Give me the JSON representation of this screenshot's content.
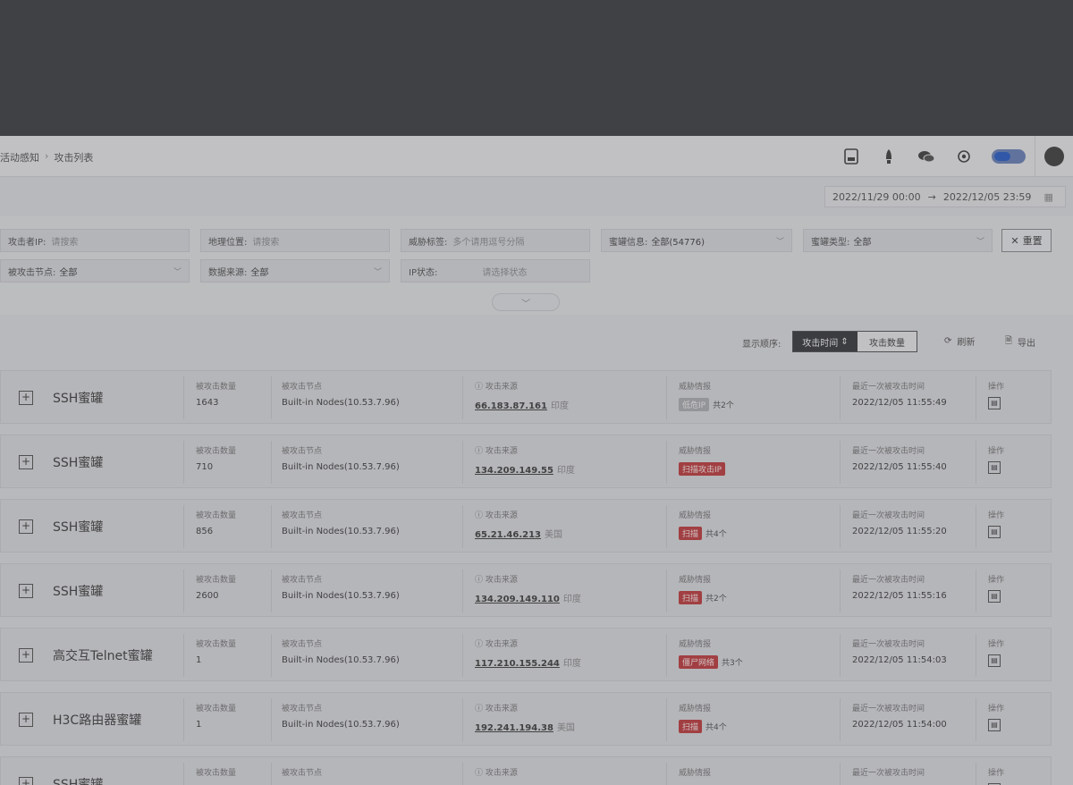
{
  "breadcrumb": [
    "活动感知",
    "攻击列表"
  ],
  "header": {
    "icons": [
      "database-icon",
      "rocket-icon",
      "chat-icon",
      "gear-icon"
    ],
    "toggle_on": true
  },
  "date_range": {
    "start": "2022/11/29 00:00",
    "end": "2022/12/05 23:59"
  },
  "filters": {
    "row1": [
      {
        "label": "攻击者IP:",
        "placeholder": "请搜索"
      },
      {
        "label": "地理位置:",
        "placeholder": "请搜索"
      },
      {
        "label": "威胁标签:",
        "placeholder": "多个请用逗号分隔"
      },
      {
        "label": "蜜罐信息:",
        "value": "全部(54776)"
      },
      {
        "label": "蜜罐类型:",
        "value": "全部"
      }
    ],
    "row2": [
      {
        "label": "被攻击节点:",
        "value": "全部"
      },
      {
        "label": "数据来源:",
        "value": "全部"
      },
      {
        "label": "IP状态:",
        "placeholder": "请选择状态"
      }
    ],
    "reset_label": "重置"
  },
  "sort": {
    "label": "显示顺序:",
    "options": [
      "攻击时间",
      "攻击数量"
    ],
    "refresh_label": "刷新",
    "export_label": "导出"
  },
  "columns": {
    "count": "被攻击数量",
    "node": "被攻击节点",
    "source": "攻击来源",
    "threat": "威胁情报",
    "last": "最近一次被攻击时间",
    "op": "操作"
  },
  "rows": [
    {
      "name": "SSH蜜罐",
      "count": "1643",
      "node": "Built-in Nodes(10.53.7.96)",
      "ip": "66.183.87.161",
      "loc": "印度",
      "tag": "低危IP",
      "tag_color": "gray",
      "tag_count": "共2个",
      "time": "2022/12/05 11:55:49"
    },
    {
      "name": "SSH蜜罐",
      "count": "710",
      "node": "Built-in Nodes(10.53.7.96)",
      "ip": "134.209.149.55",
      "loc": "印度",
      "tag": "扫描攻击IP",
      "tag_color": "red",
      "tag_count": "",
      "time": "2022/12/05 11:55:40"
    },
    {
      "name": "SSH蜜罐",
      "count": "856",
      "node": "Built-in Nodes(10.53.7.96)",
      "ip": "65.21.46.213",
      "loc": "美国",
      "tag": "扫描",
      "tag_color": "red",
      "tag_count": "共4个",
      "time": "2022/12/05 11:55:20"
    },
    {
      "name": "SSH蜜罐",
      "count": "2600",
      "node": "Built-in Nodes(10.53.7.96)",
      "ip": "134.209.149.110",
      "loc": "印度",
      "tag": "扫描",
      "tag_color": "red",
      "tag_count": "共2个",
      "time": "2022/12/05 11:55:16"
    },
    {
      "name": "高交互Telnet蜜罐",
      "count": "1",
      "node": "Built-in Nodes(10.53.7.96)",
      "ip": "117.210.155.244",
      "loc": "印度",
      "tag": "僵尸网络",
      "tag_color": "red",
      "tag_count": "共3个",
      "time": "2022/12/05 11:54:03"
    },
    {
      "name": "H3C路由器蜜罐",
      "count": "1",
      "node": "Built-in Nodes(10.53.7.96)",
      "ip": "192.241.194.38",
      "loc": "美国",
      "tag": "扫描",
      "tag_color": "red",
      "tag_count": "共4个",
      "time": "2022/12/05 11:54:00"
    },
    {
      "name": "SSH蜜罐",
      "count": "",
      "node": "",
      "ip": "",
      "loc": "",
      "tag": "",
      "tag_color": "",
      "tag_count": "",
      "time": ""
    }
  ]
}
